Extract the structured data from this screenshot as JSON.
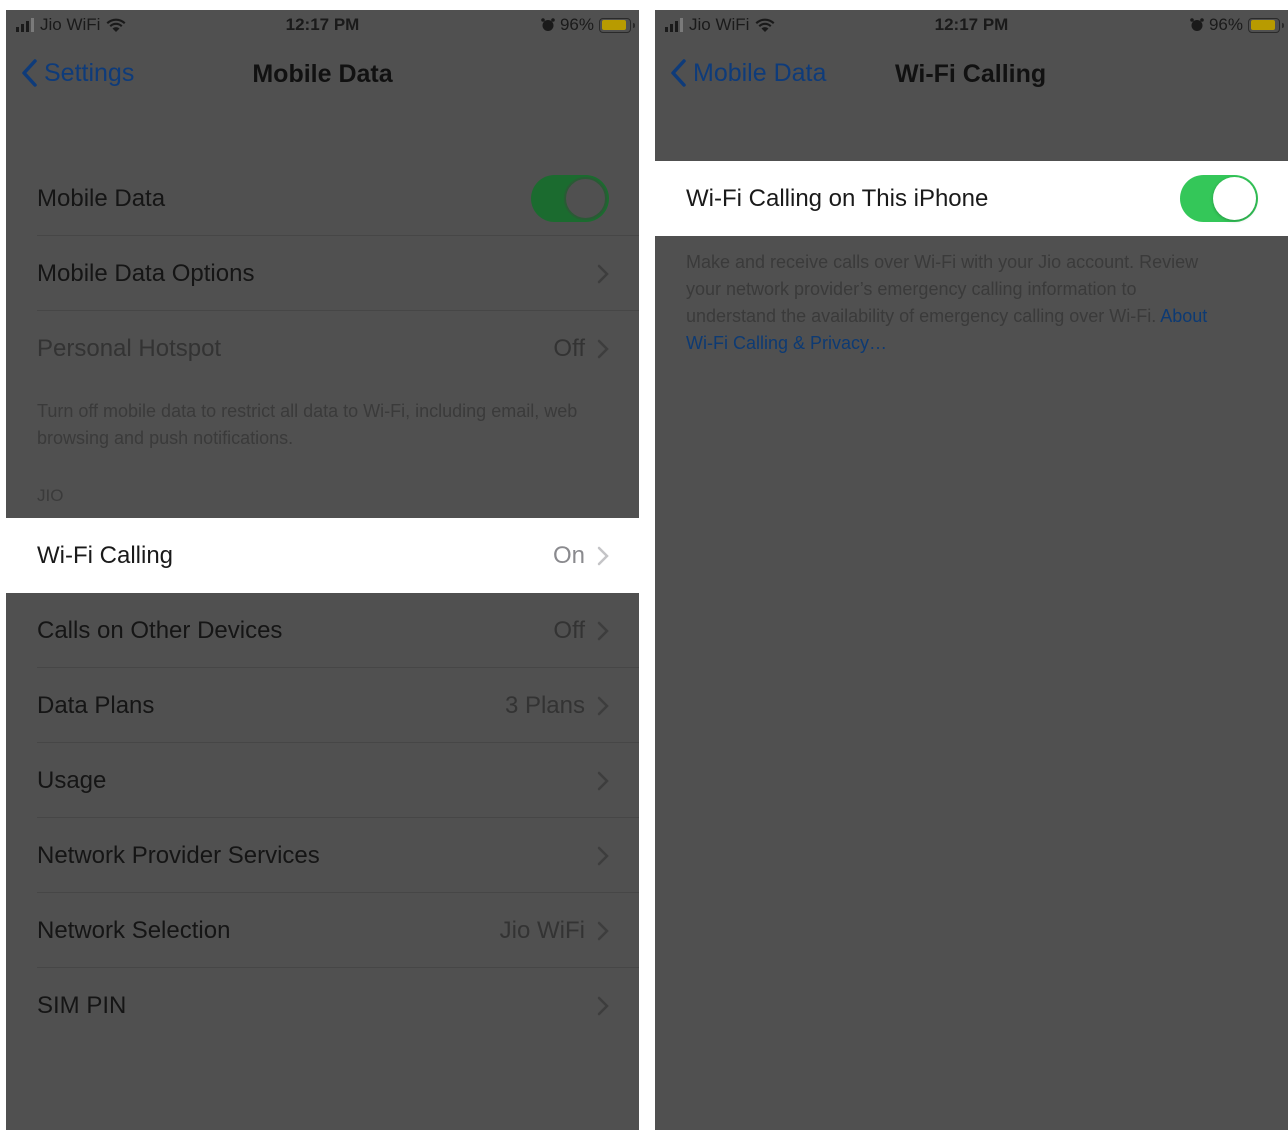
{
  "left_screen": {
    "status": {
      "carrier": "Jio WiFi",
      "time": "12:17 PM",
      "battery": "96%"
    },
    "nav": {
      "back_label": "Settings",
      "title": "Mobile Data"
    },
    "group1": {
      "mobile_data_label": "Mobile Data",
      "mobile_data_toggle": "on",
      "options_label": "Mobile Data Options",
      "hotspot_label": "Personal Hotspot",
      "hotspot_value": "Off"
    },
    "group1_footer": "Turn off mobile data to restrict all data to Wi-Fi, including email, web browsing and push notifications.",
    "section_header": "JIO",
    "group2": {
      "wifi_calling_label": "Wi-Fi Calling",
      "wifi_calling_value": "On",
      "other_devices_label": "Calls on Other Devices",
      "other_devices_value": "Off",
      "data_plans_label": "Data Plans",
      "data_plans_value": "3 Plans",
      "usage_label": "Usage",
      "provider_services_label": "Network Provider Services",
      "network_selection_label": "Network Selection",
      "network_selection_value": "Jio WiFi",
      "sim_pin_label": "SIM PIN"
    }
  },
  "right_screen": {
    "status": {
      "carrier": "Jio WiFi",
      "time": "12:17 PM",
      "battery": "96%"
    },
    "nav": {
      "back_label": "Mobile Data",
      "title": "Wi-Fi Calling"
    },
    "toggle_row": {
      "label": "Wi-Fi Calling on This iPhone",
      "state": "on"
    },
    "footer_text": "Make and receive calls over Wi-Fi with your Jio account. Review your network provider’s emergency calling information to understand the availability of emergency calling over Wi-Fi.",
    "footer_link": "About Wi-Fi Calling & Privacy…"
  },
  "colors": {
    "dim_overlay": "#505050",
    "toggle_on": "#34c759",
    "link_blue": "#007aff",
    "battery_yellow": "#ffcc00"
  }
}
